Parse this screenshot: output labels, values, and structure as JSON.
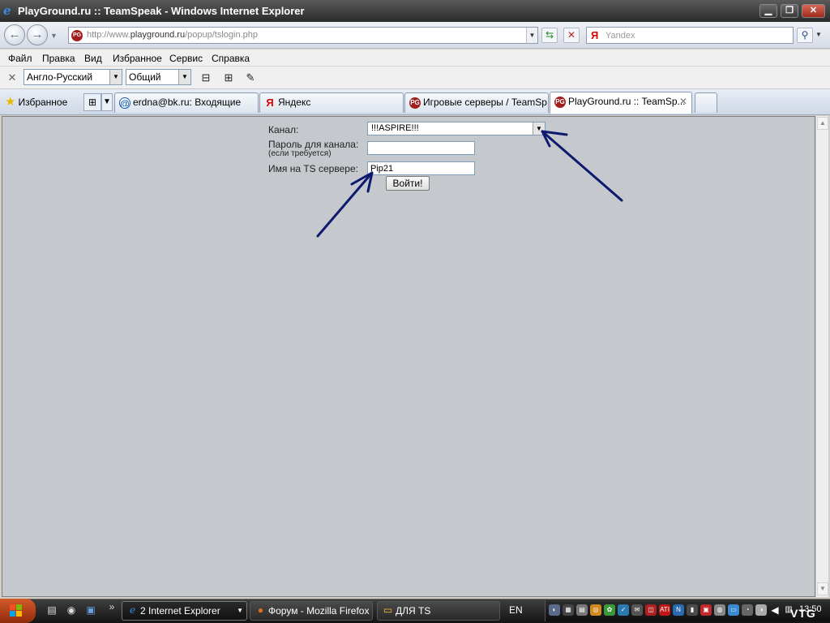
{
  "window": {
    "title": "PlayGround.ru :: TeamSpeak - Windows Internet Explorer",
    "min_glyph": "▁",
    "max_glyph": "❐",
    "close_glyph": "✕"
  },
  "nav": {
    "back_glyph": "←",
    "forward_glyph": "→",
    "address_prefix": "http://www.",
    "address_domain": "playground.ru",
    "address_path": "/popup/tslogin.php",
    "search_logo": "Я",
    "search_placeholder": "Yandex"
  },
  "menu": {
    "items": [
      "Файл",
      "Правка",
      "Вид",
      "Избранное",
      "Сервис",
      "Справка"
    ]
  },
  "toolbar": {
    "dictionary": "Англо-Русский",
    "topic": "Общий"
  },
  "favorites_label": "Избранное",
  "tabs": [
    {
      "label": "erdna@bk.ru: Входящие",
      "icon": "@"
    },
    {
      "label": "Яндекс",
      "icon": "Я"
    },
    {
      "label": "Игровые серверы / TeamSp...",
      "icon": "PG"
    },
    {
      "label": "PlayGround.ru :: TeamSp...",
      "icon": "PG"
    }
  ],
  "form": {
    "channel_label": "Канал:",
    "channel_value": "!!!ASPIRE!!!",
    "password_label": "Пароль для канала:",
    "password_hint": "(если требуется)",
    "password_value": "",
    "name_label": "Имя на TS сервере:",
    "name_value": "Pip21",
    "submit_label": "Войти!"
  },
  "taskbar": {
    "quicklaunch_more": "»",
    "tasks": [
      {
        "label": "2 Internet Explorer",
        "icon": "e"
      },
      {
        "label": "Форум - Mozilla Firefox",
        "icon": "●"
      },
      {
        "label": "ДЛЯ TS",
        "icon": "▭"
      }
    ],
    "lang": "EN",
    "clock": "13:50",
    "watermark": "VTG"
  },
  "colors": {
    "content_bg": "#c5c8cd",
    "arrow": "#0d1a6e",
    "pg_red": "#a31e1e"
  }
}
